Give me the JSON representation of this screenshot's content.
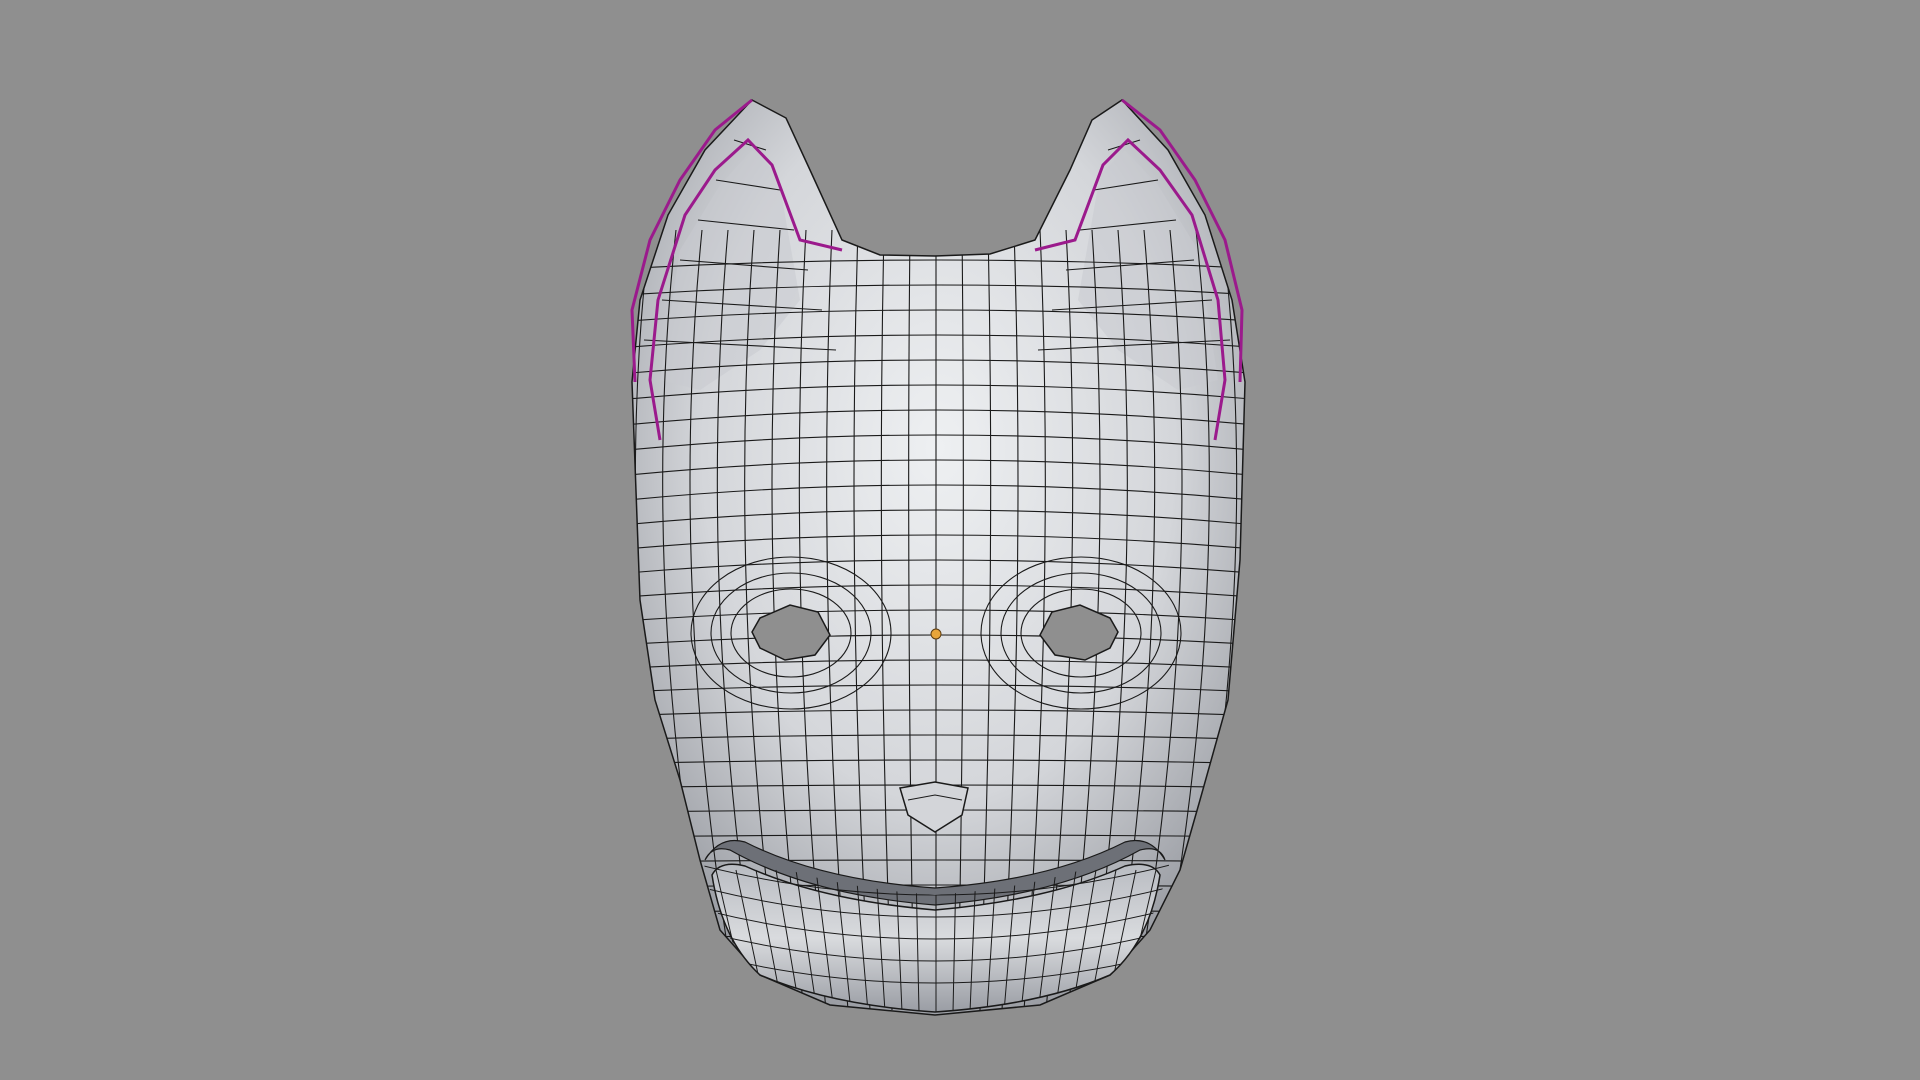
{
  "viewport": {
    "background_color": "#8f8f8f",
    "mode": "edit-mode-wireframe-over-solid",
    "object": "fox-mask-mesh"
  },
  "colors": {
    "mesh_fill_light": "#e6e7ea",
    "mesh_fill_mid": "#c6c8cc",
    "mesh_fill_dark": "#7f828a",
    "wire": "#1a1a1a",
    "selected_edges": "#9b1a8c",
    "origin_point": "#e8a53a"
  },
  "icons": {
    "origin": "origin-dot-icon"
  }
}
